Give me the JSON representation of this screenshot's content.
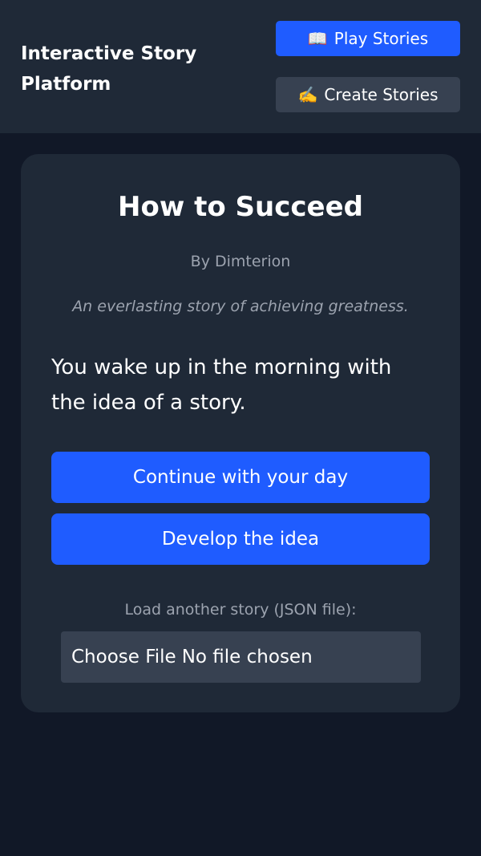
{
  "header": {
    "brand_line1": "Interactive Story",
    "brand_line2": "Platform",
    "play_icon": "📖",
    "play_label": "Play Stories",
    "create_icon": "✍️",
    "create_label": "Create Stories"
  },
  "story": {
    "title": "How to Succeed",
    "author": "By Dimterion",
    "description": "An everlasting story of achieving greatness.",
    "text": "You wake up in the morning with the idea of a story.",
    "choices": [
      {
        "label": "Continue with your day"
      },
      {
        "label": "Develop the idea"
      }
    ]
  },
  "loader": {
    "label": "Load another story (JSON file):",
    "button_label": "Choose File",
    "status": "No file chosen"
  },
  "colors": {
    "background": "#111827",
    "panel": "#1f2937",
    "primary": "#1f5cff",
    "secondary": "#374151",
    "muted_text": "#9ca3af"
  }
}
